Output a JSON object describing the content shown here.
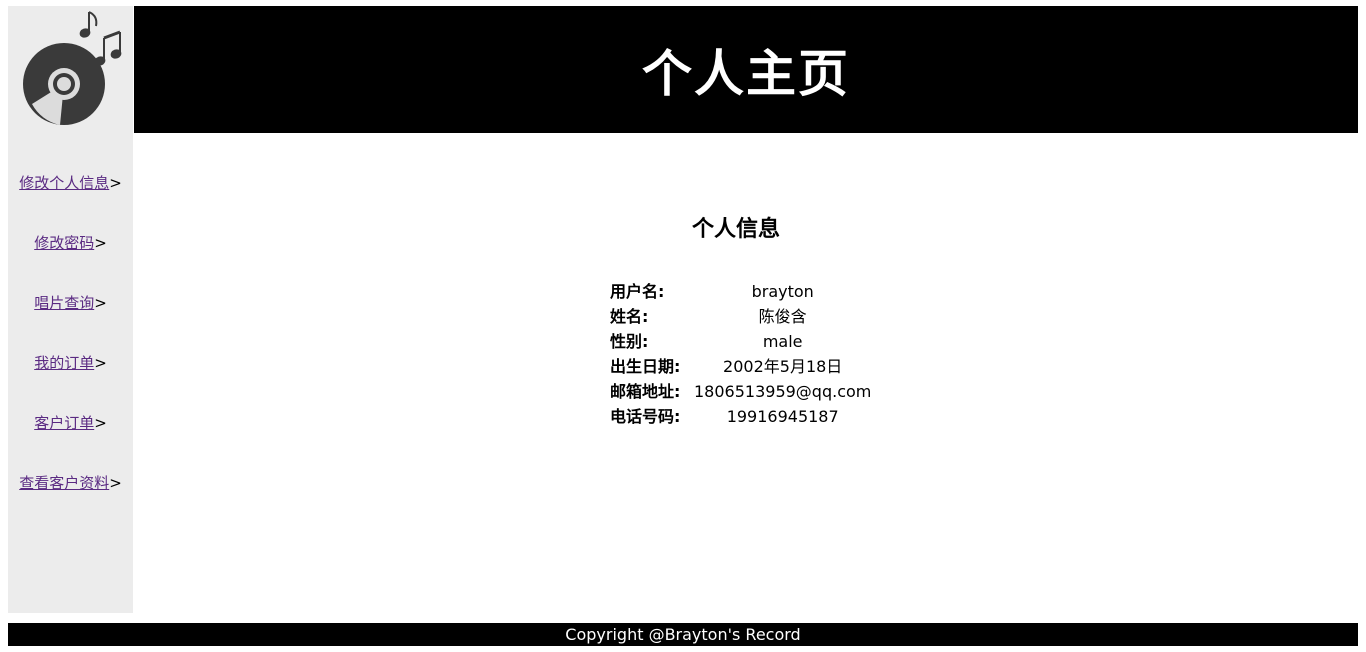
{
  "header": {
    "title": "个人主页"
  },
  "sidebar": {
    "items": [
      {
        "label": "修改个人信息",
        "arrow": ">"
      },
      {
        "label": "修改密码",
        "arrow": ">"
      },
      {
        "label": "唱片查询",
        "arrow": ">"
      },
      {
        "label": "我的订单",
        "arrow": ">"
      },
      {
        "label": "客户订单",
        "arrow": ">"
      },
      {
        "label": "查看客户资料",
        "arrow": ">"
      }
    ]
  },
  "main": {
    "section_title": "个人信息",
    "fields": [
      {
        "label": "用户名:",
        "value": "brayton"
      },
      {
        "label": "姓名:",
        "value": "陈俊含"
      },
      {
        "label": "性别:",
        "value": "male"
      },
      {
        "label": "出生日期:",
        "value": "2002年5月18日"
      },
      {
        "label": "邮箱地址:",
        "value": "1806513959@qq.com"
      },
      {
        "label": "电话号码:",
        "value": "19916945187"
      }
    ]
  },
  "footer": {
    "text": "Copyright @Brayton's Record"
  },
  "colors": {
    "header_bg": "#000000",
    "sidebar_bg": "#ececec",
    "link": "#5a2a82",
    "footer_bg": "#000000"
  },
  "icons": {
    "logo": "vinyl-record-music-notes-icon"
  }
}
